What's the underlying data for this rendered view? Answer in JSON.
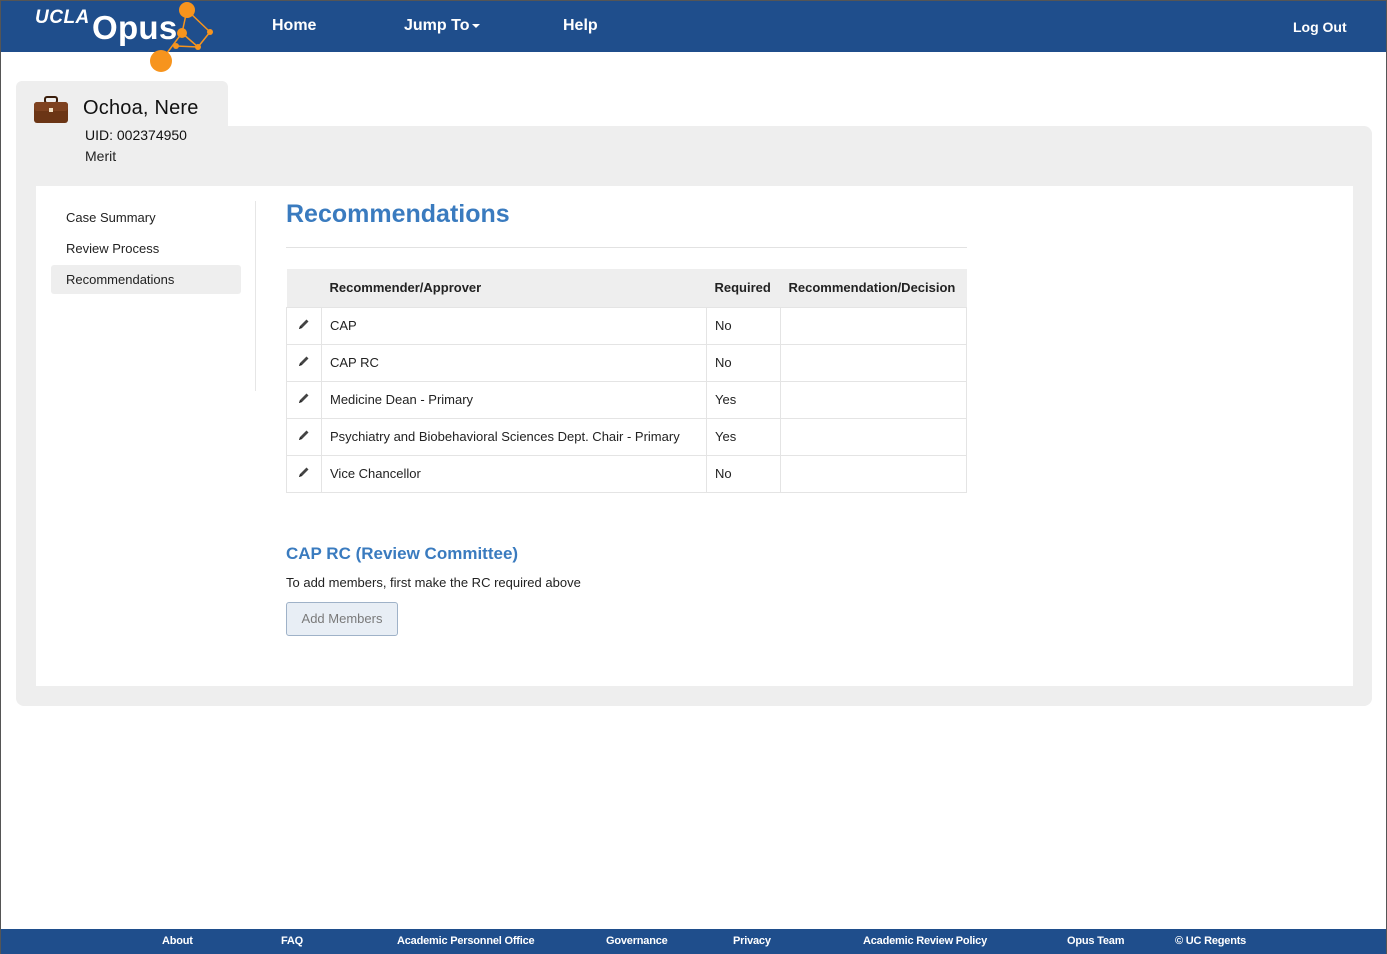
{
  "brand": {
    "ucla": "UCLA",
    "opus": "Opus"
  },
  "nav": {
    "home": "Home",
    "jump_to": "Jump To",
    "help": "Help",
    "logout": "Log Out"
  },
  "case": {
    "name": "Ochoa, Nere",
    "uid": "UID: 002374950",
    "type": "Merit"
  },
  "sidebar": {
    "items": [
      {
        "label": "Case Summary"
      },
      {
        "label": "Review Process"
      },
      {
        "label": "Recommendations"
      }
    ],
    "active": "Recommendations"
  },
  "main": {
    "title": "Recommendations",
    "table": {
      "headers": [
        "Recommender/Approver",
        "Required",
        "Recommendation/Decision"
      ],
      "rows": [
        {
          "approver": "CAP",
          "required": "No",
          "decision": ""
        },
        {
          "approver": "CAP RC",
          "required": "No",
          "decision": ""
        },
        {
          "approver": "Medicine Dean - Primary",
          "required": "Yes",
          "decision": ""
        },
        {
          "approver": "Psychiatry and Biobehavioral Sciences Dept. Chair - Primary",
          "required": "Yes",
          "decision": ""
        },
        {
          "approver": "Vice Chancellor",
          "required": "No",
          "decision": ""
        }
      ]
    },
    "rc": {
      "title": "CAP RC (Review Committee)",
      "note": "To add members, first make the RC required above",
      "button": "Add Members"
    }
  },
  "footer": {
    "links": [
      "About",
      "FAQ",
      "Academic Personnel Office",
      "Governance",
      "Privacy",
      "Academic Review Policy",
      "Opus Team",
      "© UC Regents"
    ]
  },
  "colors": {
    "nav_bg": "#1f4e8c",
    "accent_orange": "#f7941d",
    "title_blue": "#3a7bbf",
    "panel_gray": "#eeeeee"
  }
}
